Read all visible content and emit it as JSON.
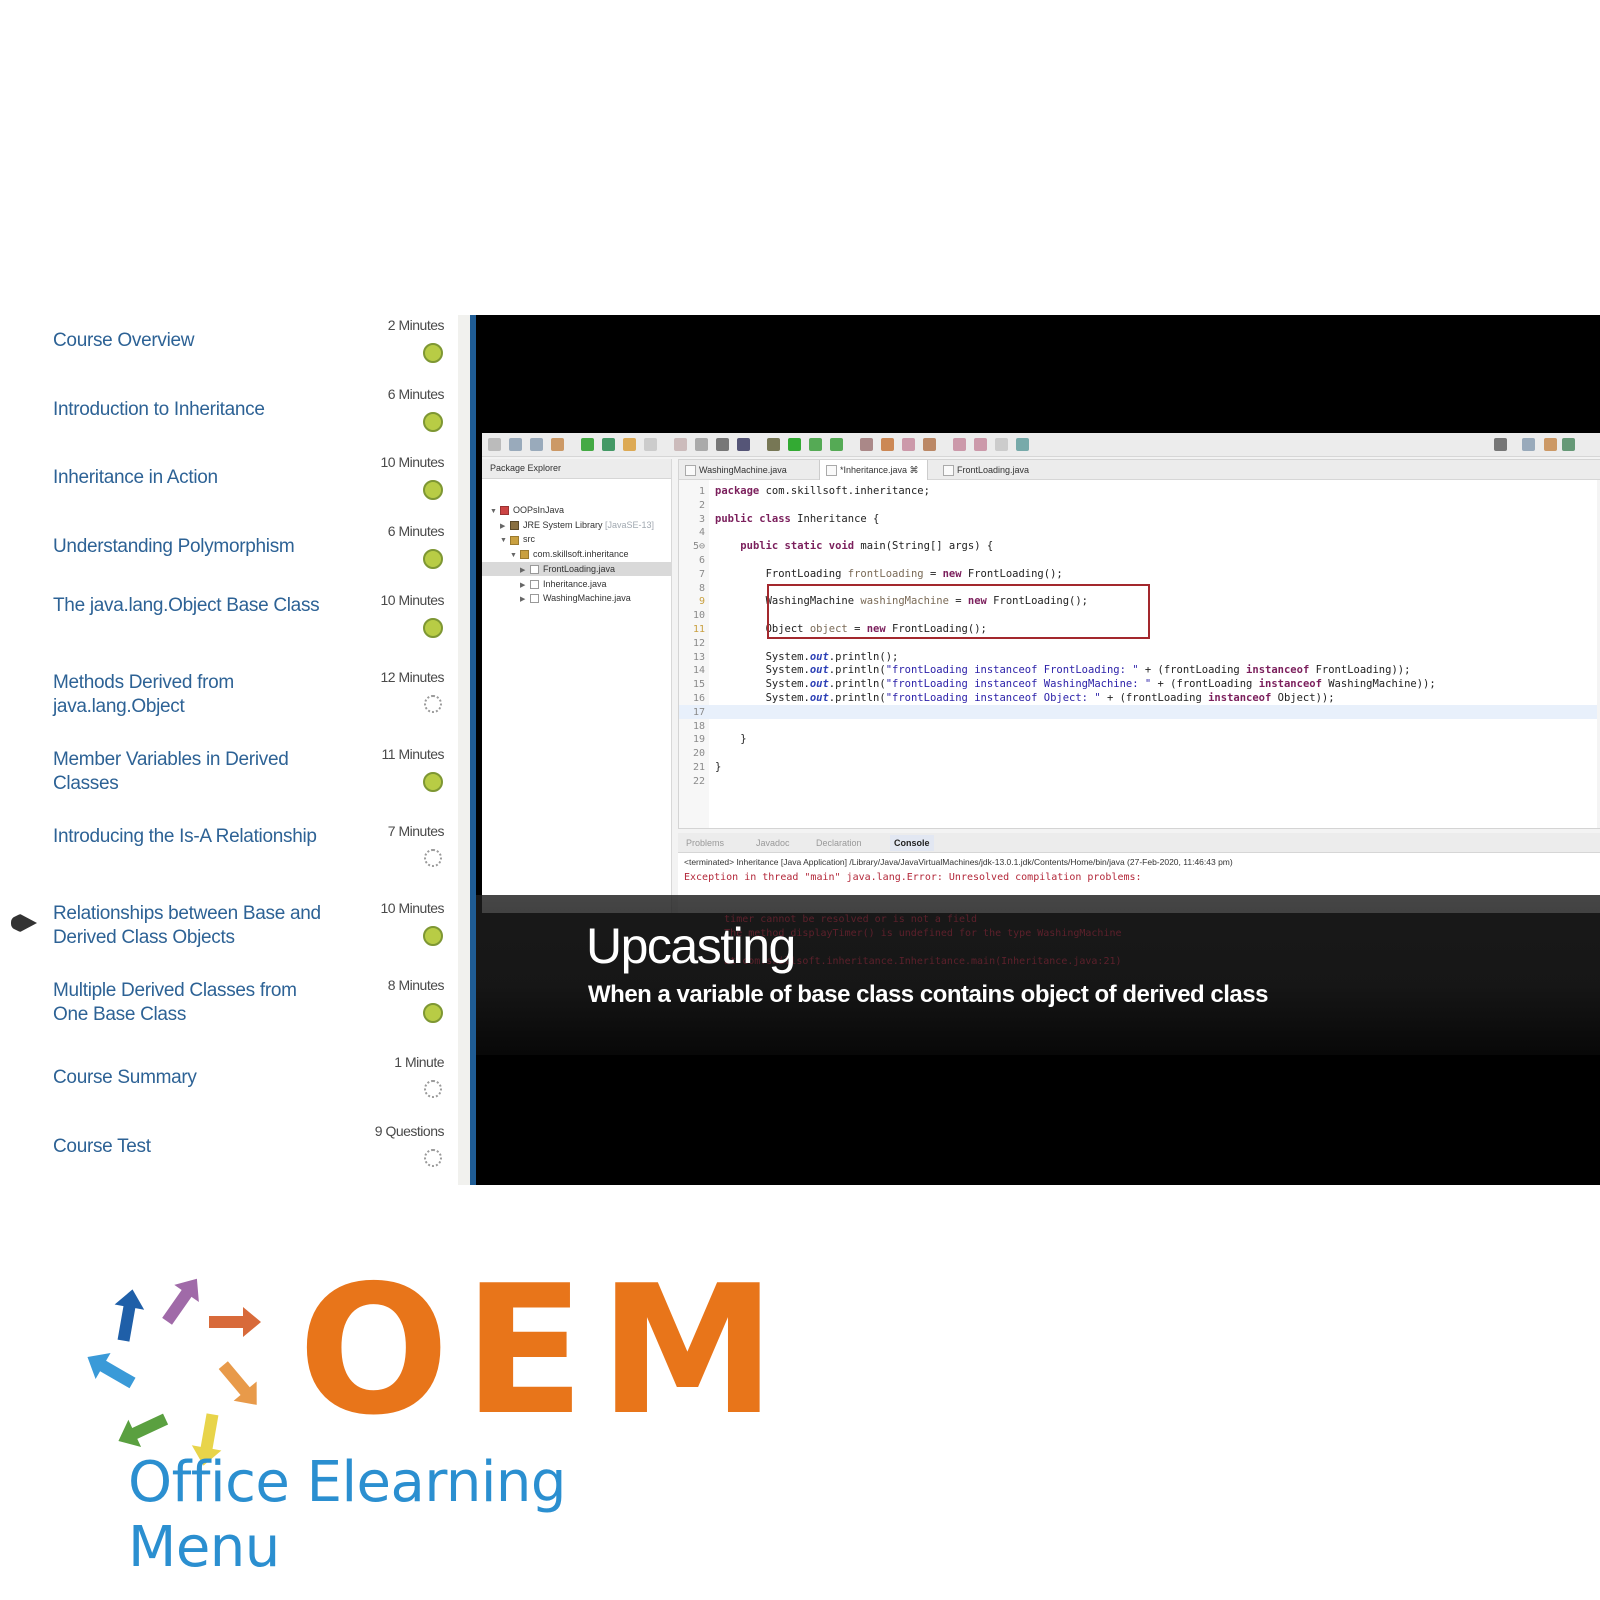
{
  "course_outline": {
    "items": [
      {
        "title": "Course Overview",
        "duration": "2 Minutes",
        "status": "completed"
      },
      {
        "title": "Introduction to Inheritance",
        "duration": "6 Minutes",
        "status": "completed"
      },
      {
        "title": "Inheritance in Action",
        "duration": "10 Minutes",
        "status": "completed"
      },
      {
        "title": "Understanding Polymorphism",
        "duration": "6 Minutes",
        "status": "completed"
      },
      {
        "title": "The java.lang.Object Base Class",
        "duration": "10 Minutes",
        "status": "completed"
      },
      {
        "title": "Methods Derived from java.lang.Object",
        "duration": "12 Minutes",
        "status": "not-started"
      },
      {
        "title": "Member Variables in Derived Classes",
        "duration": "11 Minutes",
        "status": "completed"
      },
      {
        "title": "Introducing the Is-A Relationship",
        "duration": "7 Minutes",
        "status": "not-started"
      },
      {
        "title": "Relationships between Base and Derived Class Objects",
        "duration": "10 Minutes",
        "status": "completed",
        "current": true
      },
      {
        "title": "Multiple Derived Classes from One Base Class",
        "duration": "8 Minutes",
        "status": "completed"
      },
      {
        "title": "Course Summary",
        "duration": "1 Minute",
        "status": "not-started"
      },
      {
        "title": "Course Test",
        "duration": "9 Questions",
        "status": "not-started"
      }
    ],
    "status_colors": {
      "completed": "#b8cc45",
      "not-started": "#9a9a9a"
    },
    "title_color": "#2d6295",
    "current_marker_icon": "current-lesson-pointer-icon"
  },
  "video": {
    "accent_color": "#1f5c94",
    "ide": {
      "package_explorer": {
        "title": "Package Explorer",
        "tree": [
          {
            "label": "OOPsInJava",
            "level": 0,
            "expanded": true,
            "icon": "project-icon"
          },
          {
            "label": "JRE System Library",
            "suffix": "[JavaSE-13]",
            "level": 1,
            "expanded": false,
            "icon": "library-icon"
          },
          {
            "label": "src",
            "level": 1,
            "expanded": true,
            "icon": "source-folder-icon"
          },
          {
            "label": "com.skillsoft.inheritance",
            "level": 2,
            "expanded": true,
            "icon": "package-icon"
          },
          {
            "label": "FrontLoading.java",
            "level": 3,
            "expanded": false,
            "icon": "java-file-icon",
            "selected": true
          },
          {
            "label": "Inheritance.java",
            "level": 3,
            "expanded": false,
            "icon": "java-file-icon"
          },
          {
            "label": "WashingMachine.java",
            "level": 3,
            "expanded": false,
            "icon": "java-file-icon"
          }
        ]
      },
      "editor_tabs": [
        {
          "label": "WashingMachine.java",
          "active": false
        },
        {
          "label": "*Inheritance.java",
          "active": true
        },
        {
          "label": "FrontLoading.java",
          "active": false
        }
      ],
      "code_lines": [
        {
          "n": "1",
          "html": "<span class='kw'>package</span> com.skillsoft.inheritance;"
        },
        {
          "n": "2",
          "html": ""
        },
        {
          "n": "3",
          "html": "<span class='kw'>public class</span> Inheritance {"
        },
        {
          "n": "4",
          "html": ""
        },
        {
          "n": "5⊖",
          "html": "    <span class='kw'>public static void</span> main(String[] args) {"
        },
        {
          "n": "6",
          "html": ""
        },
        {
          "n": "7",
          "html": "        FrontLoading <span class='var'>frontLoading</span> = <span class='kw'>new</span> FrontLoading();"
        },
        {
          "n": "8",
          "html": ""
        },
        {
          "n": "9",
          "html": "        WashingMachine <span class='var'>washingMachine</span> = <span class='kw'>new</span> FrontLoading();",
          "warning": true
        },
        {
          "n": "10",
          "html": ""
        },
        {
          "n": "11",
          "html": "        Object <span class='var'>object</span> = <span class='kw'>new</span> FrontLoading();",
          "warning": true
        },
        {
          "n": "12",
          "html": ""
        },
        {
          "n": "13",
          "html": "        System.<span class='fld'>out</span>.println();"
        },
        {
          "n": "14",
          "html": "        System.<span class='fld'>out</span>.println(<span class='str'>\"frontLoading instanceof FrontLoading: \"</span> + (frontLoading <span class='kw'>instanceof</span> FrontLoading));"
        },
        {
          "n": "15",
          "html": "        System.<span class='fld'>out</span>.println(<span class='str'>\"frontLoading instanceof WashingMachine: \"</span> + (frontLoading <span class='kw'>instanceof</span> WashingMachine));"
        },
        {
          "n": "16",
          "html": "        System.<span class='fld'>out</span>.println(<span class='str'>\"frontLoading instanceof Object: \"</span> + (frontLoading <span class='kw'>instanceof</span> Object));"
        },
        {
          "n": "17",
          "html": "",
          "current": true
        },
        {
          "n": "18",
          "html": ""
        },
        {
          "n": "19",
          "html": "    }"
        },
        {
          "n": "20",
          "html": ""
        },
        {
          "n": "21",
          "html": "}"
        },
        {
          "n": "22",
          "html": ""
        }
      ],
      "console": {
        "tabs": [
          {
            "label": "Problems",
            "active": false
          },
          {
            "label": "Javadoc",
            "active": false
          },
          {
            "label": "Declaration",
            "active": false
          },
          {
            "label": "Console",
            "active": true
          }
        ],
        "terminated_line": "<terminated> Inheritance [Java Application] /Library/Java/JavaVirtualMachines/jdk-13.0.1.jdk/Contents/Home/bin/java (27-Feb-2020, 11:46:43 pm)",
        "error_lines": [
          "Exception in thread \"main\" java.lang.Error: Unresolved compilation problems:",
          "\ttimer cannot be resolved or is not a field",
          "\tThe method displayTimer() is undefined for the type WashingMachine",
          "",
          "\tat com.skillsoft.inheritance.Inheritance.main(Inheritance.java:21)"
        ]
      }
    },
    "caption": {
      "title": "Upcasting",
      "subtitle": "When a variable of base class contains object of derived class"
    }
  },
  "logo": {
    "wordmark": "OEM",
    "name": "Office Elearning Menu",
    "wordmark_color": "#e8751a",
    "name_color": "#2b8fd0",
    "arrow_colors": [
      "#1f5fa8",
      "#a06aa8",
      "#d86a3a",
      "#e89a4a",
      "#e8d44a",
      "#5aa040",
      "#3a9ad8"
    ]
  }
}
